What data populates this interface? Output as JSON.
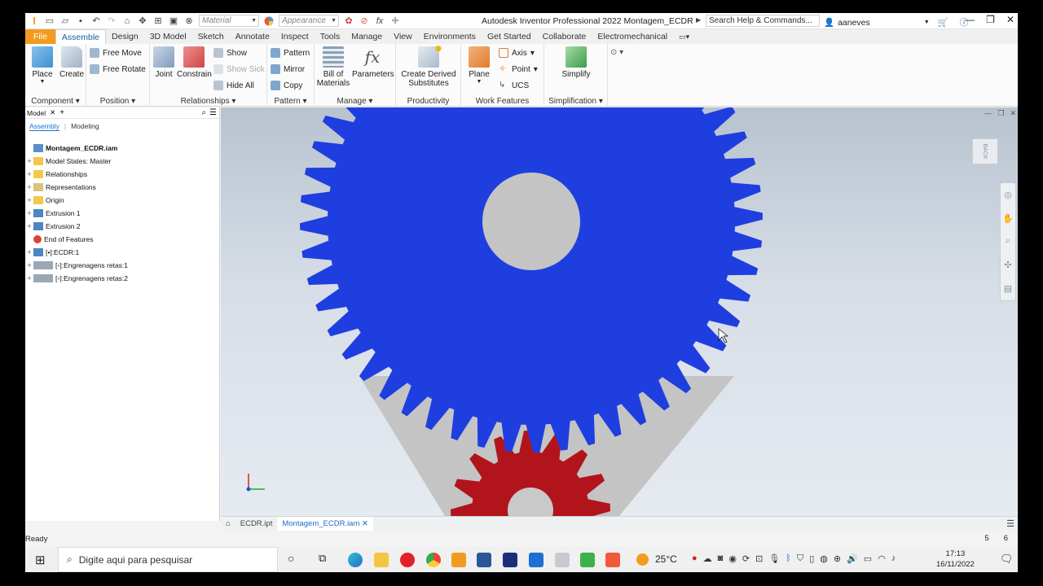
{
  "titlebar": {
    "material_placeholder": "Material",
    "appearance_placeholder": "Appearance",
    "title": "Autodesk Inventor Professional 2022   Montagem_ECDR",
    "search_placeholder": "Search Help & Commands...",
    "user": "aaneves"
  },
  "tabs": [
    "File",
    "Assemble",
    "Design",
    "3D Model",
    "Sketch",
    "Annotate",
    "Inspect",
    "Tools",
    "Manage",
    "View",
    "Environments",
    "Get Started",
    "Collaborate",
    "Electromechanical"
  ],
  "ribbon": {
    "component": {
      "place": "Place",
      "create": "Create",
      "label": "Component"
    },
    "position": {
      "free_move": "Free Move",
      "free_rotate": "Free Rotate",
      "label": "Position"
    },
    "relationships": {
      "joint": "Joint",
      "constrain": "Constrain",
      "show": "Show",
      "show_sick": "Show Sick",
      "hide_all": "Hide All",
      "label": "Relationships"
    },
    "pattern": {
      "pattern": "Pattern",
      "mirror": "Mirror",
      "copy": "Copy",
      "label": "Pattern"
    },
    "manage": {
      "bom_line1": "Bill of",
      "bom_line2": "Materials",
      "parameters": "Parameters",
      "label": "Manage"
    },
    "productivity": {
      "line1": "Create Derived",
      "line2": "Substitutes",
      "label": "Productivity"
    },
    "work_features": {
      "plane": "Plane",
      "axis": "Axis",
      "point": "Point",
      "ucs": "UCS",
      "label": "Work Features"
    },
    "simplification": {
      "simplify": "Simplify",
      "label": "Simplification"
    }
  },
  "browser": {
    "title": "Model",
    "sub_assembly": "Assembly",
    "sub_modeling": "Modeling",
    "root": "Montagem_ECDR.iam",
    "items": [
      {
        "label": "Model States: Master"
      },
      {
        "label": "Relationships"
      },
      {
        "label": "Representations"
      },
      {
        "label": "Origin"
      },
      {
        "label": "Extrusion 1"
      },
      {
        "label": "Extrusion 2"
      },
      {
        "label": "End of Features"
      },
      {
        "label": "[•]:ECDR:1"
      },
      {
        "label": "[▫]:Engrenagens retas:1"
      },
      {
        "label": "[▫]:Engrenagens retas:2"
      }
    ]
  },
  "viewport": {
    "viewcube_label": "BACK"
  },
  "doc_tabs": [
    "ECDR.ipt",
    "Montagem_ECDR.iam"
  ],
  "status": {
    "text": "Ready",
    "num1": "5",
    "num2": "6"
  },
  "taskbar": {
    "search": "Digite aqui para pesquisar",
    "weather": "25°C",
    "time": "17:13",
    "date": "16/11/2022"
  },
  "colors": {
    "large_gear": "#1f3ee0",
    "small_gear": "#b2141b",
    "file_tab": "#f29c1f",
    "base_plate": "#c4c4c4"
  }
}
